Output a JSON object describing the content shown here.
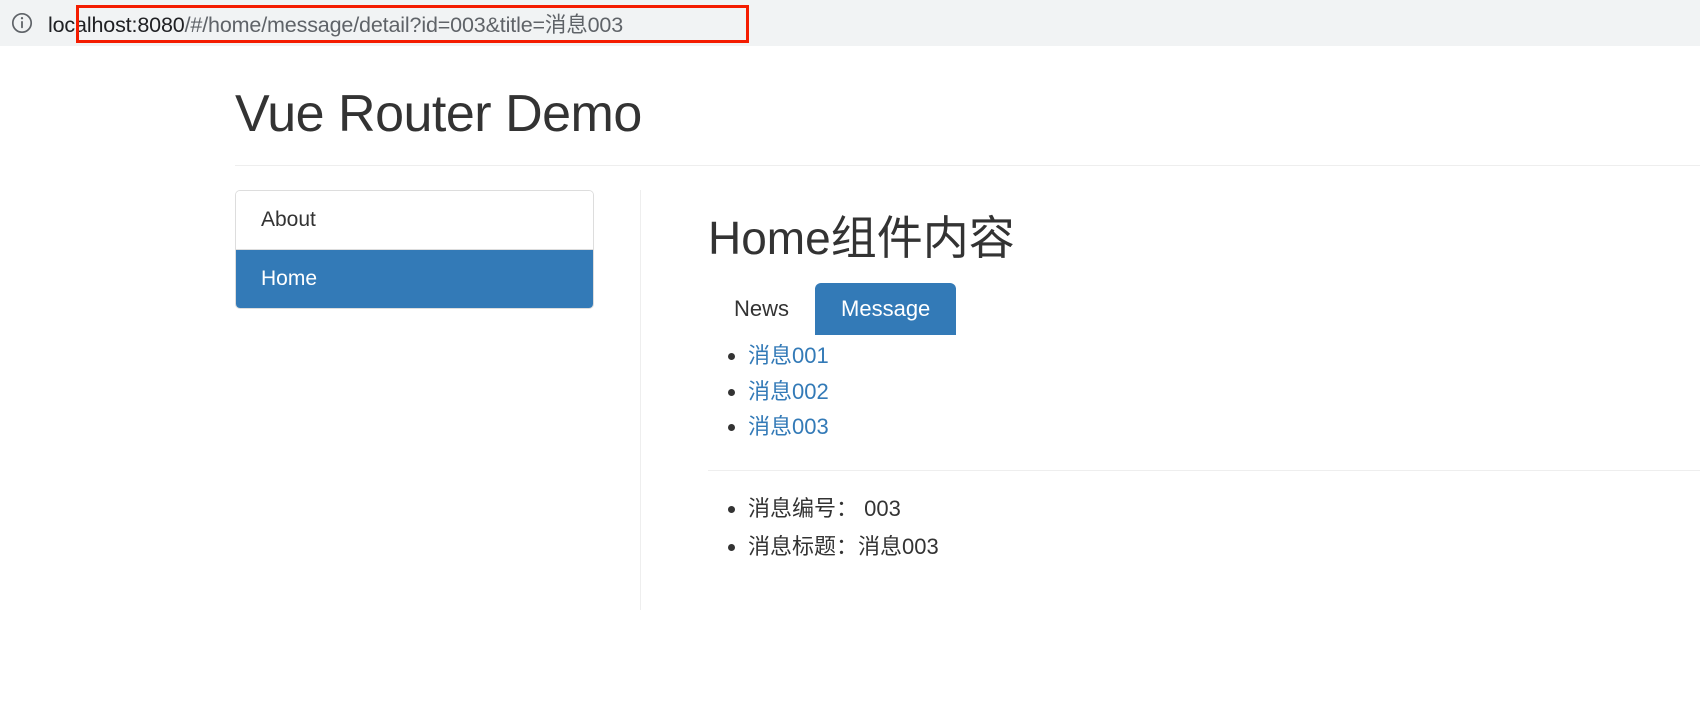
{
  "browser": {
    "info_icon": "info-circle-icon",
    "url_host": "localhost:8080",
    "url_path": "/#/home/message/detail?id=003&title=消息003",
    "url_full": "localhost:8080/#/home/message/detail?id=003&title=消息003",
    "highlight_color": "#f41c00"
  },
  "app": {
    "title": "Vue Router Demo",
    "accent_color": "#337ab7"
  },
  "sidebar": {
    "items": [
      {
        "label": "About",
        "active": false
      },
      {
        "label": "Home",
        "active": true
      }
    ]
  },
  "main": {
    "heading": "Home组件内容",
    "tabs": [
      {
        "label": "News",
        "active": false
      },
      {
        "label": "Message",
        "active": true
      }
    ],
    "messages": [
      {
        "label": "消息001"
      },
      {
        "label": "消息002"
      },
      {
        "label": "消息003"
      }
    ],
    "detail": [
      {
        "label": "消息编号：",
        "value": "003",
        "text": "消息编号： 003"
      },
      {
        "label": "消息标题：",
        "value": "消息003",
        "text": "消息标题：消息003"
      }
    ]
  }
}
